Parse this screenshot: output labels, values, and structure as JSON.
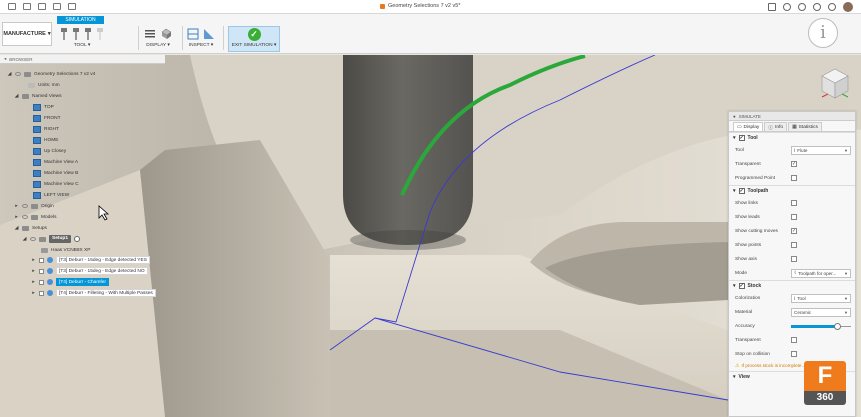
{
  "window": {
    "doc_title": "Geometry Selections 7 v2 v5*"
  },
  "toolbar": {
    "workspace_label": "MANUFACTURE",
    "active_tab": "SIMULATION",
    "groups": {
      "tool": "TOOL",
      "display": "DISPLAY",
      "inspect": "INSPECT",
      "exit": "EXIT SIMULATION"
    },
    "info_glyph": "i"
  },
  "browser": {
    "header": "BROWSER",
    "root": "Geometry Selections 7 v2 v4",
    "units": "Units: mm",
    "named_views_label": "Named Views",
    "named_views": [
      "TOP",
      "FRONT",
      "RIGHT",
      "HOME",
      "Up Closey",
      "Machine View A",
      "Machine View B",
      "Machine View C",
      "LEFT VIEW"
    ],
    "origin": "Origin",
    "models": "Models",
    "setups": "Setups",
    "setup": "Setup1",
    "machine": "Haas VCNB8X XP",
    "operations": [
      "[T3] Deburr - 15deg - Edge detected YES",
      "[T3] Deburr - 15deg - Edge detected NO",
      "[T4] Deburr - Chamfer",
      "[T4] Deburr - Filleting - With Multiple Passes"
    ],
    "selected_operation_index": 2
  },
  "simulate_panel": {
    "title": "SIMULATE",
    "tabs": [
      "Display",
      "Info",
      "Statistics"
    ],
    "tool_section": {
      "label": "Tool",
      "rows": {
        "tool": {
          "label": "Tool",
          "value": "Flute"
        },
        "transparent": {
          "label": "Transparent",
          "checked": true
        },
        "programmed_point": {
          "label": "Programmed Point",
          "checked": false
        }
      }
    },
    "toolpath_section": {
      "label": "Toolpath",
      "rows": {
        "show_links": {
          "label": "Show links",
          "checked": false
        },
        "show_leads": {
          "label": "Show leads",
          "checked": false
        },
        "show_cutting_moves": {
          "label": "Show cutting moves",
          "checked": true
        },
        "show_points": {
          "label": "Show points",
          "checked": false
        },
        "show_axis": {
          "label": "Show axis",
          "checked": false
        },
        "mode": {
          "label": "Mode",
          "value": "Toolpath for oper..."
        }
      }
    },
    "stock_section": {
      "label": "Stock",
      "rows": {
        "colorization": {
          "label": "Colorization",
          "value": "Tool"
        },
        "material": {
          "label": "Material",
          "value": "Ceramic"
        },
        "accuracy": {
          "label": "Accuracy",
          "level": 0.78
        },
        "transparent": {
          "label": "Transparent",
          "checked": false
        },
        "stop_on_collision": {
          "label": "Stop on collision",
          "checked": false
        }
      },
      "warning": "If process stock is incomplete... inaccurate."
    },
    "view_section": {
      "label": "View"
    }
  },
  "badge": {
    "letter": "F",
    "number": "360"
  },
  "colors": {
    "accent": "#0696d7",
    "toolpath_cut": "#2aa83a",
    "toolpath_line": "#3a3ad0",
    "tool_color": "#5e5c57",
    "badge": "#f07b1c"
  }
}
